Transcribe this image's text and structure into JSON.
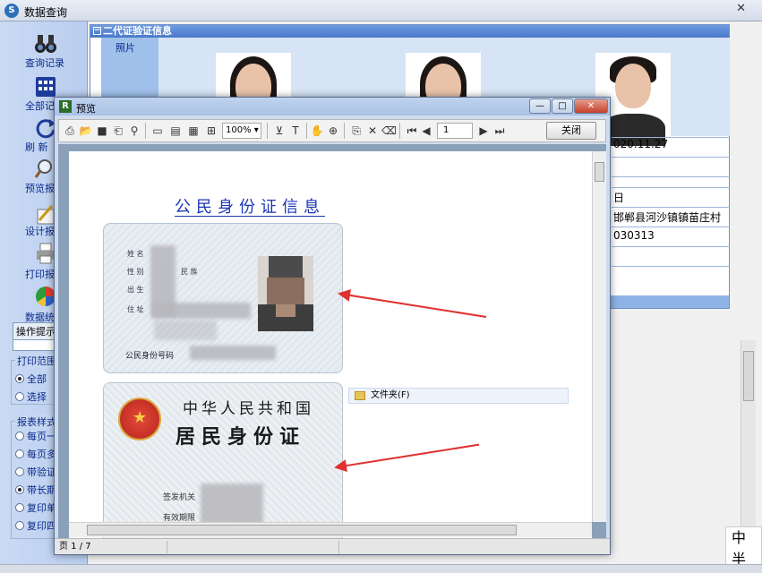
{
  "main_window": {
    "title": "数据查询"
  },
  "left_toolbar": {
    "tools": [
      {
        "label": "查询记录",
        "icon": "binoculars-icon"
      },
      {
        "label": "全部记",
        "icon": "grid-icon"
      },
      {
        "label": "刷  新",
        "icon": "refresh-icon"
      },
      {
        "label": "预览报",
        "icon": "magnifier-icon"
      },
      {
        "label": "设计报",
        "icon": "design-icon"
      },
      {
        "label": "打印报",
        "icon": "printer-icon"
      },
      {
        "label": "数据统",
        "icon": "pie-chart-icon"
      }
    ],
    "hint_label": "操作提示",
    "print_range": {
      "title": "打印范围",
      "options": [
        {
          "label": "全部",
          "selected": true
        },
        {
          "label": "选择",
          "selected": false
        }
      ]
    },
    "report_style": {
      "title": "报表样式",
      "options": [
        {
          "label": "每页一",
          "selected": false
        },
        {
          "label": "每页多",
          "selected": false
        },
        {
          "label": "带验证",
          "selected": false
        },
        {
          "label": "带长期",
          "selected": true
        },
        {
          "label": "复印单",
          "selected": false
        },
        {
          "label": "复印四",
          "selected": false
        }
      ]
    }
  },
  "cert_panel": {
    "header": "二代证验证信息",
    "photo_label": "照片",
    "info_rows": [
      "日",
      "邯郸县河沙镇镇苗庄村",
      "030313",
      "",
      "020.11.27"
    ]
  },
  "watermark": {
    "lines": [
      "中",
      "半"
    ]
  },
  "preview": {
    "title": "预览",
    "zoom": "100%",
    "page_number": "1",
    "close_label": "关闭",
    "document_title": "公民身份证信息",
    "front_labels": [
      "姓 名",
      "性 别",
      "民 族",
      "出 生",
      "住 址"
    ],
    "front_number_label": "公民身份号码",
    "back_line1": "中华人民共和国",
    "back_line2": "居民身份证",
    "back_authority": "签发机关",
    "back_valid": "有效期限",
    "folder_item": "文件夹(F)",
    "status_page": "页 1 / 7"
  },
  "colors": {
    "accent_blue": "#1b36b5",
    "arrow_red": "#e0312e",
    "panel_header": "#4878c8"
  }
}
